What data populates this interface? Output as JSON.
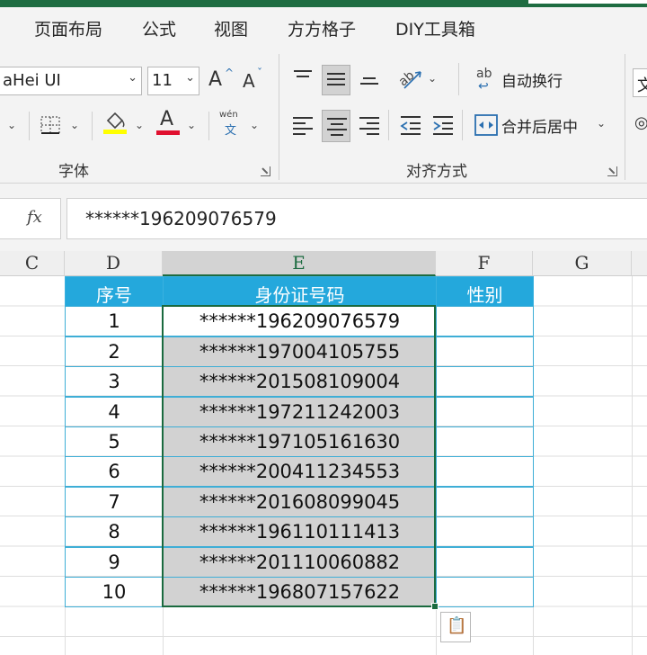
{
  "tabs": [
    "页面布局",
    "公式",
    "视图",
    "方方格子",
    "DIY工具箱"
  ],
  "ribbon": {
    "font_name": "aHei UI",
    "font_size": "11",
    "grow_font_icon": "A",
    "shrink_font_icon": "A",
    "font_color_icon": "A",
    "phonetic_icon_top": "wén",
    "phonetic_icon_bottom": "文",
    "wrap_icon": "ab",
    "wrap_text": "自动换行",
    "merge_center": "合并后居中",
    "group_font": "字体",
    "group_alignment": "对齐方式",
    "cut_off_right": "文",
    "highlight_color": "#ffff00",
    "font_color": "#e0102f"
  },
  "formula_bar": {
    "fx_label": "fx",
    "value": "******196209076579"
  },
  "columns": [
    "C",
    "D",
    "E",
    "F",
    "G"
  ],
  "table": {
    "headers": [
      "序号",
      "身份证号码",
      "性别"
    ],
    "rows": [
      {
        "no": "1",
        "id": "******196209076579",
        "gender": ""
      },
      {
        "no": "2",
        "id": "******197004105755",
        "gender": ""
      },
      {
        "no": "3",
        "id": "******201508109004",
        "gender": ""
      },
      {
        "no": "4",
        "id": "******197211242003",
        "gender": ""
      },
      {
        "no": "5",
        "id": "******197105161630",
        "gender": ""
      },
      {
        "no": "6",
        "id": "******200411234553",
        "gender": ""
      },
      {
        "no": "7",
        "id": "******201608099045",
        "gender": ""
      },
      {
        "no": "8",
        "id": "******196110111413",
        "gender": ""
      },
      {
        "no": "9",
        "id": "******201110060882",
        "gender": ""
      },
      {
        "no": "10",
        "id": "******196807157622",
        "gender": ""
      }
    ],
    "header_color": "#24a8dc",
    "selected_fill": "#d2d2d2",
    "selection_border": "#1a6a3f"
  },
  "quick_analysis_icon": "clipboard-lightning-icon"
}
